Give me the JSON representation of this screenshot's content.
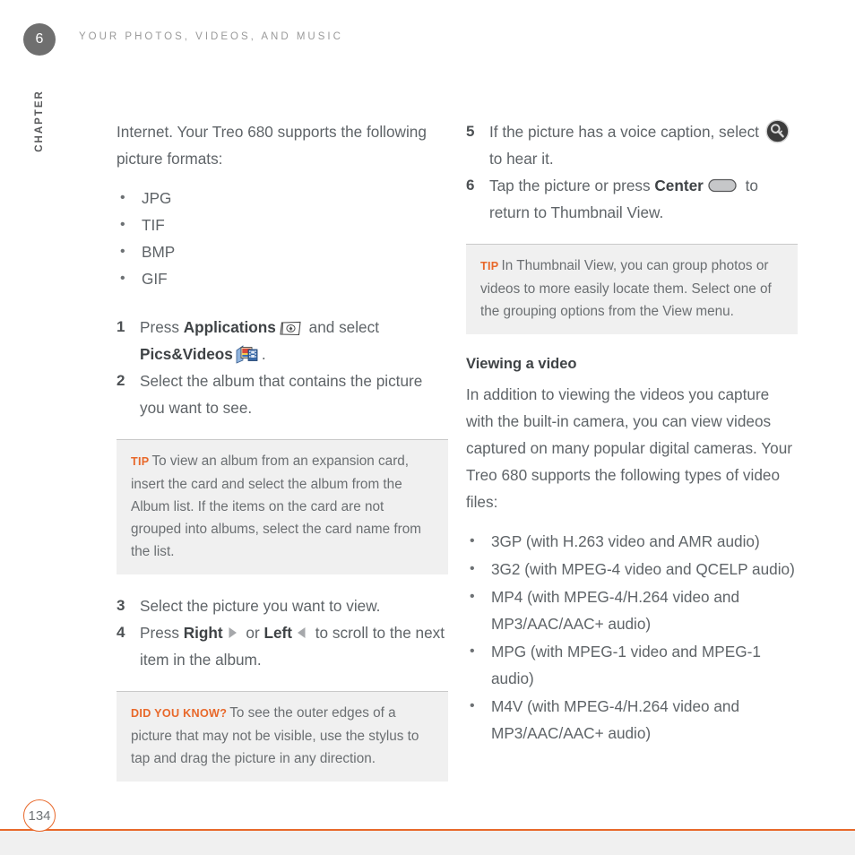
{
  "header": {
    "chapter_number": "6",
    "chapter_word": "CHAPTER",
    "running_head": "YOUR PHOTOS, VIDEOS, AND MUSIC"
  },
  "footer": {
    "page_number": "134",
    "rule_color": "#e8682a"
  },
  "colors": {
    "accent_orange": "#e8682a",
    "body_text": "#5f6468",
    "bold_text": "#3f4346",
    "note_background": "#f0f0f0",
    "chapter_badge": "#6f6f6f"
  },
  "left_column": {
    "intro_paragraph": "Internet. Your Treo 680 supports the following picture formats:",
    "picture_formats": [
      "JPG",
      "TIF",
      "BMP",
      "GIF"
    ],
    "step1": {
      "number": "1",
      "text_before_bold": "Press ",
      "bold1": "Applications",
      "icon1": "applications-key-icon",
      "text_middle": " and select ",
      "bold2": "Pics&Videos",
      "icon2": "pics-and-videos-app-icon",
      "text_after": "."
    },
    "step2": {
      "number": "2",
      "text": "Select the album that contains the picture you want to see."
    },
    "tip_box": {
      "label": "TIP",
      "text": "To view an album from an expansion card, insert the card and select the album from the Album list. If the items on the card are not grouped into albums, select the card name from the list."
    },
    "step3": {
      "number": "3",
      "text": "Select the picture you want to view."
    },
    "step4": {
      "number": "4",
      "text_before": "Press ",
      "bold1": "Right",
      "icon1": "triangle-right-icon",
      "text_middle": " or ",
      "bold2": "Left",
      "icon2": "triangle-left-icon",
      "text_after": " to scroll to the next item in the album."
    },
    "did_you_know_box": {
      "label": "DID YOU KNOW?",
      "text": "To see the outer edges of a picture that may not be visible, use the stylus to tap and drag the picture in any direction."
    }
  },
  "right_column": {
    "step5": {
      "number": "5",
      "text_before": "If the picture has a voice caption, select ",
      "icon": "voice-caption-icon",
      "text_after": " to hear it."
    },
    "step6": {
      "number": "6",
      "text_before": "Tap the picture or press ",
      "bold": "Center",
      "icon": "center-key-icon",
      "text_after": " to return to Thumbnail View."
    },
    "tip_box": {
      "label": "TIP",
      "text": "In Thumbnail View, you can group photos or videos to more easily locate them. Select one of the grouping options from the View menu."
    },
    "section": {
      "heading": "Viewing a video",
      "paragraph": "In addition to viewing the videos you capture with the built-in camera, you can view videos captured on many popular digital cameras. Your Treo 680 supports the following types of video files:",
      "video_formats": [
        "3GP (with H.263 video and AMR audio)",
        "3G2 (with MPEG-4 video and QCELP audio)",
        "MP4 (with MPEG-4/H.264 video and MP3/AAC/AAC+ audio)",
        "MPG (with MPEG-1 video and MPEG-1 audio)",
        "M4V (with MPEG-4/H.264 video and MP3/AAC/AAC+ audio)"
      ]
    }
  }
}
